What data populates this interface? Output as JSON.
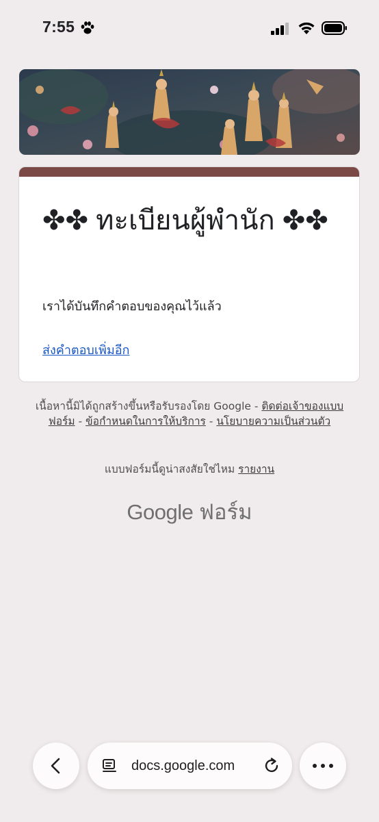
{
  "status_bar": {
    "time": "7:55"
  },
  "banner": {
    "icon": "thai-mural-banner-image"
  },
  "form": {
    "accent_color": "#7b4a47",
    "title": "✤✤ ทะเบียนผู้พำนัก ✤✤",
    "confirmation": "เราได้บันทึกคำตอบของคุณไว้แล้ว",
    "submit_another": "ส่งคำตอบเพิ่มอีก"
  },
  "footer": {
    "disclaimer_prefix": "เนื้อหานี้มิได้ถูกสร้างขึ้นหรือรับรองโดย Google - ",
    "contact_owner": "ติดต่อเจ้าของแบบฟอร์ม",
    "terms": "ข้อกำหนดในการให้บริการ",
    "privacy": "นโยบายความเป็นส่วนตัว",
    "separator": " - ",
    "abuse_prefix": "แบบฟอร์มนี้ดูน่าสงสัยใช่ไหม ",
    "report": "รายงาน",
    "brand_google": "Google",
    "brand_forms": "ฟอร์ม"
  },
  "browser": {
    "url": "docs.google.com",
    "back_icon": "chevron-left-icon",
    "tabs_icon": "page-settings-icon",
    "reload_icon": "reload-icon",
    "more_icon": "more-dots-icon"
  }
}
